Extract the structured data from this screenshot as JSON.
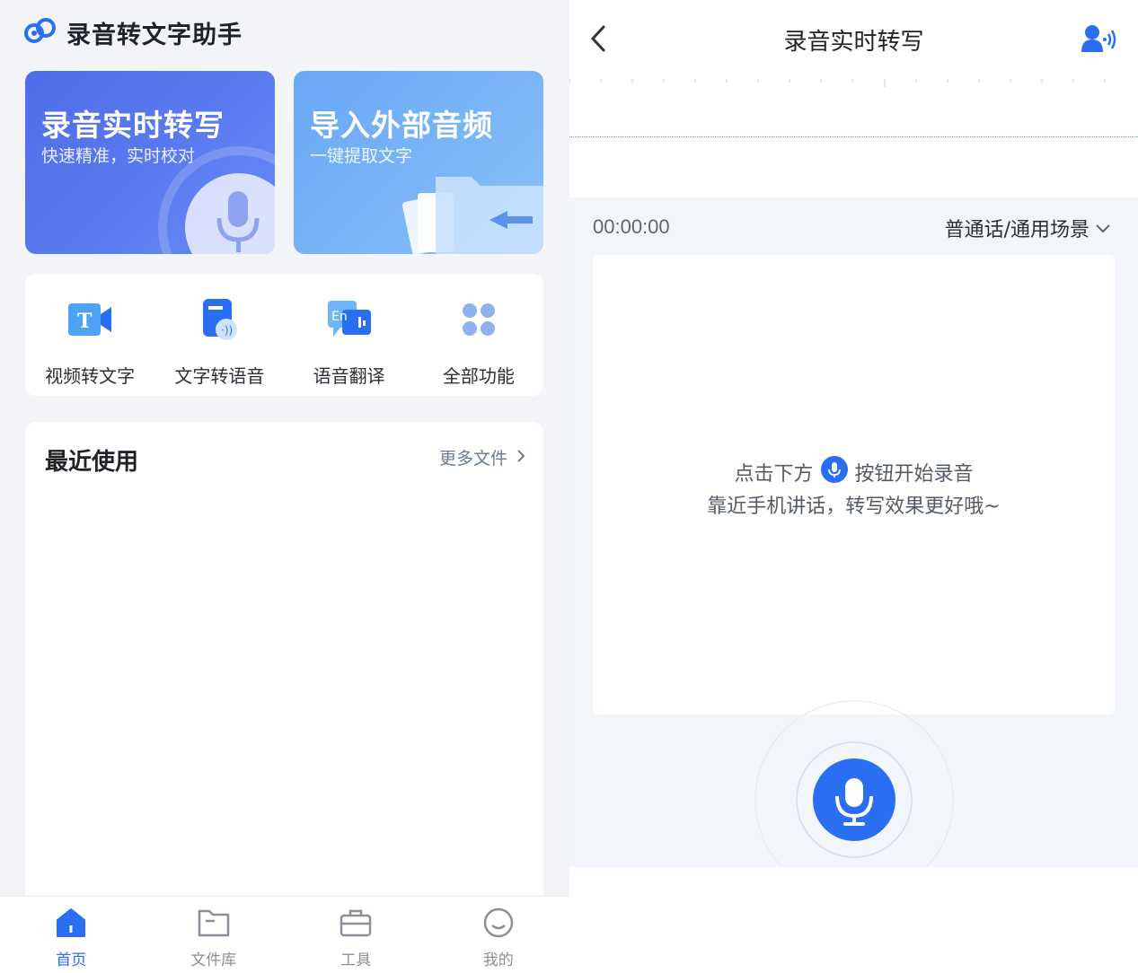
{
  "left": {
    "app_title": "录音转文字助手",
    "logo_icon": "cloud-mic-logo-icon",
    "hero_cards": [
      {
        "title": "录音实时转写",
        "subtitle": "快速精准，实时校对",
        "icon": "microphone-icon"
      },
      {
        "title": "导入外部音频",
        "subtitle": "一键提取文字",
        "icon": "folder-import-icon"
      }
    ],
    "tools": [
      {
        "label": "视频转文字",
        "icon": "video-text-icon"
      },
      {
        "label": "文字转语音",
        "icon": "text-speech-icon"
      },
      {
        "label": "语音翻译",
        "icon": "translate-icon"
      },
      {
        "label": "全部功能",
        "icon": "all-functions-icon"
      }
    ],
    "recent": {
      "title": "最近使用",
      "more": "更多文件"
    },
    "tabbar": [
      {
        "label": "首页",
        "icon": "home-icon",
        "active": true
      },
      {
        "label": "文件库",
        "icon": "folder-icon",
        "active": false
      },
      {
        "label": "工具",
        "icon": "toolbox-icon",
        "active": false
      },
      {
        "label": "我的",
        "icon": "profile-icon",
        "active": false
      }
    ]
  },
  "right": {
    "nav_title": "录音实时转写",
    "timer": "00:00:00",
    "scene": "普通话/通用场景",
    "hint_before": "点击下方",
    "hint_after": "按钮开始录音",
    "hint_line2": "靠近手机讲话，转写效果更好哦~"
  },
  "colors": {
    "brand_blue": "#2a6ff2",
    "hero_record": "#4f6ce8",
    "hero_import": "#6aa8f5",
    "background": "#f2f4f7"
  }
}
